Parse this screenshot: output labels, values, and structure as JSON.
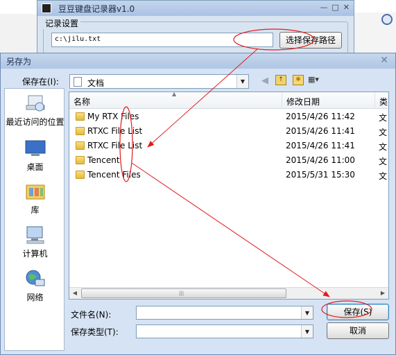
{
  "app_window": {
    "title": "豆豆键盘记录器v1.0",
    "group_label": "记录设置",
    "path_value": "c:\\jilu.txt",
    "choose_path_button": "选择保存路径"
  },
  "dialog": {
    "title": "另存为",
    "close_glyph": "✕",
    "look_in_label": "保存在(I):",
    "look_in_value": "文档",
    "places": [
      {
        "label": "最近访问的位置"
      },
      {
        "label": "桌面"
      },
      {
        "label": "库"
      },
      {
        "label": "计算机"
      },
      {
        "label": "网络"
      }
    ],
    "columns": [
      "名称",
      "修改日期",
      "类"
    ],
    "files": [
      {
        "name": "My RTX Files",
        "date": "2015/4/26 11:42",
        "type": "文"
      },
      {
        "name": "RTXC File List",
        "date": "2015/4/26 11:41",
        "type": "文"
      },
      {
        "name": "RTXC File List",
        "date": "2015/4/26 11:41",
        "type": "文"
      },
      {
        "name": "Tencent",
        "date": "2015/4/26 11:00",
        "type": "文"
      },
      {
        "name": "Tencent Files",
        "date": "2015/5/31 15:30",
        "type": "文"
      }
    ],
    "filename_label": "文件名(N):",
    "filetype_label": "保存类型(T):",
    "save_button": "保存(S)",
    "cancel_button": "取消"
  },
  "colors": {
    "annotation": "#e21b1b",
    "dialog_bg": "#d6e3f4",
    "title_text": "#1e2f4d"
  }
}
